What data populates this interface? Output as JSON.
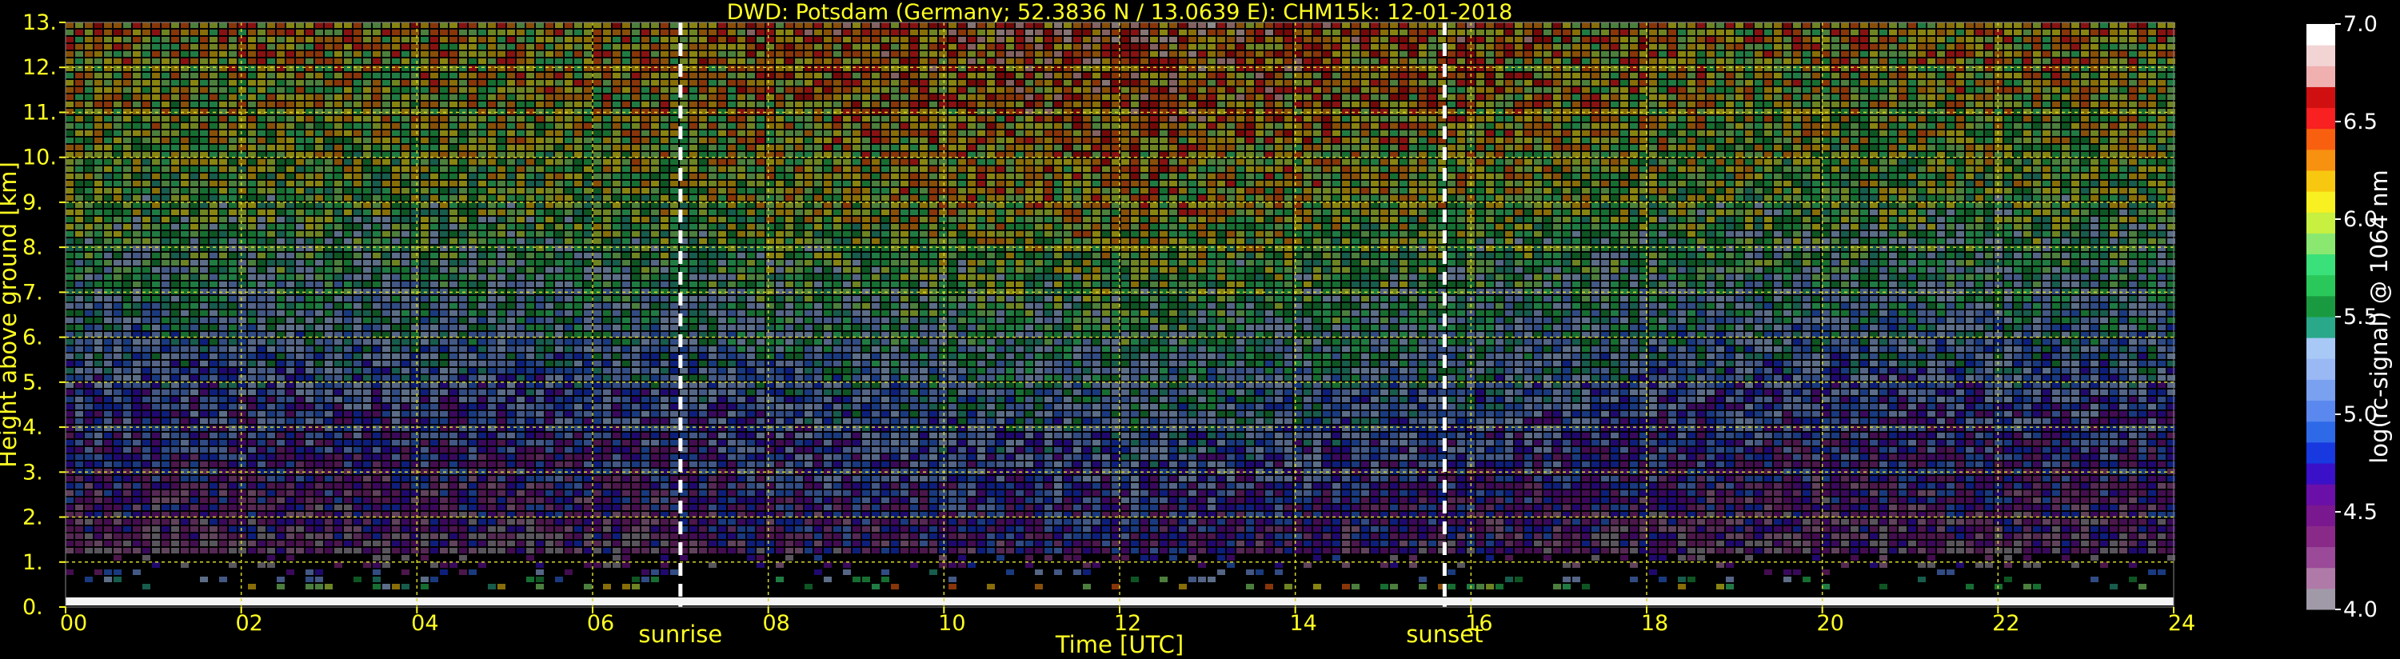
{
  "chart_data": {
    "type": "heatmap",
    "title": "DWD: Potsdam (Germany; 52.3836 N / 13.0639 E):    CHM15k: 12-01-2018",
    "xlabel": "Time [UTC]",
    "ylabel": "Height above ground [km]",
    "xlim": [
      0,
      24
    ],
    "ylim": [
      0,
      13
    ],
    "x_ticks": [
      "00",
      "02",
      "04",
      "06",
      "08",
      "10",
      "12",
      "14",
      "16",
      "18",
      "20",
      "22",
      "24"
    ],
    "y_ticks": [
      "0.",
      "1.",
      "2.",
      "3.",
      "4.",
      "5.",
      "6.",
      "7.",
      "8.",
      "9.",
      "10.",
      "11.",
      "12.",
      "13."
    ],
    "grid": true,
    "events": [
      {
        "label": "sunrise",
        "time": 7.0
      },
      {
        "label": "sunset",
        "time": 15.7
      }
    ],
    "colorbar": {
      "label": "log(rc-signal) @ 1064 nm",
      "range": [
        4.0,
        7.0
      ],
      "ticks": [
        "4.0",
        "4.5",
        "5.0",
        "5.5",
        "6.0",
        "6.5",
        "7.0"
      ],
      "colors": [
        "#a09aa8",
        "#b07aa8",
        "#9a4a98",
        "#8a2a88",
        "#7a1890",
        "#6a10a8",
        "#3a10c8",
        "#1838e0",
        "#2e6ae8",
        "#5a88ee",
        "#7aa0f0",
        "#9ab8f4",
        "#a8c8f6",
        "#2aa88a",
        "#1a9a40",
        "#2ac85a",
        "#3ae07a",
        "#8ae870",
        "#c8f040",
        "#f8f020",
        "#f8c810",
        "#f89010",
        "#f86010",
        "#f82020",
        "#d01010",
        "#f0b0b0",
        "#f2d4d4",
        "#ffffff"
      ]
    },
    "description_values": {
      "profile_heights_km": [
        0.2,
        1,
        2,
        3,
        4,
        5,
        6,
        7,
        8,
        9,
        10,
        11,
        12,
        13
      ],
      "profile_dominant_log_signal": [
        6.8,
        4.2,
        4.4,
        4.6,
        4.8,
        5.0,
        5.2,
        5.4,
        5.6,
        5.8,
        5.9,
        6.0,
        6.1,
        6.2
      ]
    }
  }
}
